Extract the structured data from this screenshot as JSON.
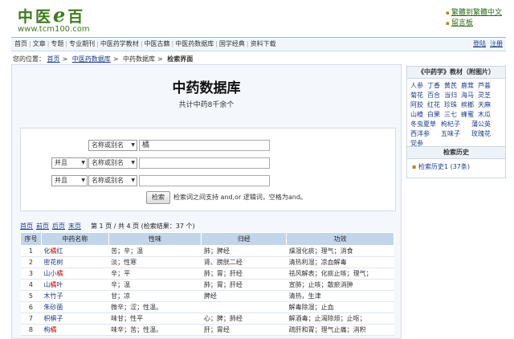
{
  "site": {
    "logo_text_a": "中医",
    "logo_e": "e",
    "logo_text_b": "百",
    "url": "www.tcm100.com"
  },
  "top_links": [
    "繁體到繁體中文",
    "留言板"
  ],
  "nav": {
    "items": [
      "首页",
      "文章",
      "专题",
      "专业期刊",
      "中医药学教材",
      "中医古籍",
      "中医药数据库",
      "国学经典",
      "资料下载"
    ],
    "right": [
      "登陆",
      "注册"
    ]
  },
  "breadcrumb": {
    "prefix": "您的位置：",
    "items": [
      "首页",
      "中医药数据库",
      "中药数据库"
    ],
    "current": "检索界面"
  },
  "main": {
    "title": "中药数据库",
    "subtitle": "共计中药8千余个"
  },
  "search": {
    "rows": [
      {
        "logic": "",
        "field": "名称或别名",
        "value": "橘"
      },
      {
        "logic": "并且",
        "field": "名称或别名",
        "value": ""
      },
      {
        "logic": "并且",
        "field": "名称或别名",
        "value": ""
      }
    ],
    "button": "检索",
    "hint": "检索词之间支持 and,or 逻辑词，空格为and。"
  },
  "pager": {
    "links": [
      "首页",
      "前页",
      "后页",
      "末页"
    ],
    "info": "第 1 页 / 共 4 页 (检索结果：37 个)"
  },
  "table": {
    "headers": [
      "序号",
      "中药名称",
      "性味",
      "归经",
      "功效"
    ],
    "rows": [
      [
        "1",
        "化橘红",
        "苦；辛；温",
        "肺；脾经",
        "燥湿化痰；理气；消食"
      ],
      [
        "2",
        "密花树",
        "淡；性寒",
        "肾、膀胱二经",
        "清热利湿；凉血解毒"
      ],
      [
        "3",
        "山小橘",
        "辛；平",
        "肺；胃；肝经",
        "祛风解表；化痰止咳；理气；"
      ],
      [
        "4",
        "山橘叶",
        "辛；温",
        "肺；胃；肝经",
        "宣肺；止咳；散瘀消肿"
      ],
      [
        "5",
        "木竹子",
        "甘；凉",
        "脾经",
        "清热，生津"
      ],
      [
        "6",
        "朱砂菌",
        "微辛；涩；性温。",
        "",
        "解毒除湿；止血"
      ],
      [
        "7",
        "枳椇子",
        "味甘；性平",
        "心；脾；肺经",
        "解酒毒；止渴除烦；止呕；"
      ],
      [
        "8",
        "枸橘",
        "味辛；苦；性温。",
        "肝；胃经",
        "疏肝和胃；理气止痛；消积"
      ]
    ]
  },
  "sidebar": {
    "herbs_title": "《中药学》教材（附图片）",
    "herbs": [
      "人参",
      "丁香",
      "黄芪",
      "鹿茸",
      "芦荟",
      "菊花",
      "百合",
      "当归",
      "海马",
      "灵芝",
      "阿胶",
      "红花",
      "珍珠",
      "槟榔",
      "天麻",
      "山楂",
      "白果",
      "三七",
      "蜂蜜",
      "木瓜",
      "冬虫夏草",
      "枸杞子",
      "蒲公英",
      "西洋参",
      "五味子",
      "玫瑰花",
      "党参"
    ],
    "history_title": "检索历史",
    "history": [
      "检索历史1 (37条)"
    ]
  }
}
